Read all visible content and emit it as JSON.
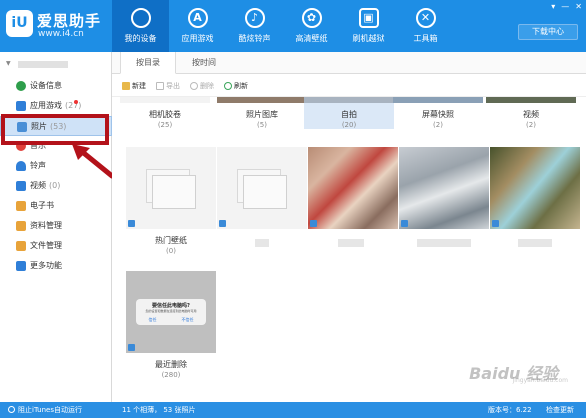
{
  "app": {
    "logo_text": "iU",
    "brand_name": "爱思助手",
    "brand_url": "www.i4.cn"
  },
  "nav": [
    {
      "label": "我的设备",
      "icon": "apple-icon",
      "glyph": "",
      "active": true
    },
    {
      "label": "应用游戏",
      "icon": "app-store-icon",
      "glyph": "A",
      "active": false
    },
    {
      "label": "酷炫铃声",
      "icon": "bell-icon",
      "glyph": "♪",
      "active": false
    },
    {
      "label": "高清壁纸",
      "icon": "flower-icon",
      "glyph": "✿",
      "active": false
    },
    {
      "label": "刷机越狱",
      "icon": "box-icon",
      "glyph": "▣",
      "active": false
    },
    {
      "label": "工具箱",
      "icon": "tools-icon",
      "glyph": "✕",
      "active": false
    }
  ],
  "window": {
    "download_label": "下载中心"
  },
  "sidebar": {
    "items": [
      {
        "label": "设备信息",
        "count": "",
        "icon": "info-icon",
        "color": "#2e9e4b"
      },
      {
        "label": "应用游戏",
        "count": "(27)",
        "icon": "apps-icon",
        "color": "#2f7fd8"
      },
      {
        "label": "照片",
        "count": "(53)",
        "icon": "photo-icon",
        "color": "#4a8fd6"
      },
      {
        "label": "音乐",
        "count": "",
        "icon": "music-icon",
        "color": "#e0403a"
      },
      {
        "label": "铃声",
        "count": "",
        "icon": "bell-icon",
        "color": "#2f7fd8"
      },
      {
        "label": "视频",
        "count": "(0)",
        "icon": "video-icon",
        "color": "#2f7fd8"
      },
      {
        "label": "电子书",
        "count": "",
        "icon": "book-icon",
        "color": "#e8a33a"
      },
      {
        "label": "资料管理",
        "count": "",
        "icon": "contacts-icon",
        "color": "#e8a33a"
      },
      {
        "label": "文件管理",
        "count": "",
        "icon": "folder-icon",
        "color": "#e8a33a"
      },
      {
        "label": "更多功能",
        "count": "",
        "icon": "grid-icon",
        "color": "#2f7fd8"
      }
    ]
  },
  "tabs": [
    {
      "label": "按目录",
      "active": true
    },
    {
      "label": "按时间",
      "active": false
    }
  ],
  "toolbar": {
    "new": "新建",
    "export": "导出",
    "delete": "删除",
    "refresh": "刷新"
  },
  "albums": [
    {
      "name": "相机胶卷",
      "count": "(25)",
      "style": "partial"
    },
    {
      "name": "照片图库",
      "count": "(5)",
      "style": "partial"
    },
    {
      "name": "自拍",
      "count": "(20)",
      "style": "partial-selected"
    },
    {
      "name": "屏幕快照",
      "count": "(2)",
      "style": "partial"
    },
    {
      "name": "视频",
      "count": "(2)",
      "style": "partial"
    },
    {
      "name": "热门壁纸",
      "count": "(0)",
      "style": "empty"
    },
    {
      "name": "",
      "count": "",
      "style": "empty"
    },
    {
      "name": "",
      "count": "",
      "style": "blur1"
    },
    {
      "name": "",
      "count": "",
      "style": "blur2"
    },
    {
      "name": "",
      "count": "",
      "style": "blur3"
    },
    {
      "name": "最近删除",
      "count": "(280)",
      "style": "phone"
    }
  ],
  "phone_dialog": {
    "title": "要信任此电脑吗?",
    "subtitle": "您的设置和数据在连接到此电脑时可用",
    "trust": "信任",
    "dont_trust": "不信任"
  },
  "status": {
    "itunes": "阻止iTunes自动运行",
    "summary": "11 个相薄， 53 张照片",
    "version": "版本号：6.22",
    "update": "检查更新"
  },
  "watermark": {
    "text": "Baidu 经验",
    "sub": "jingyan.baidu.com"
  }
}
